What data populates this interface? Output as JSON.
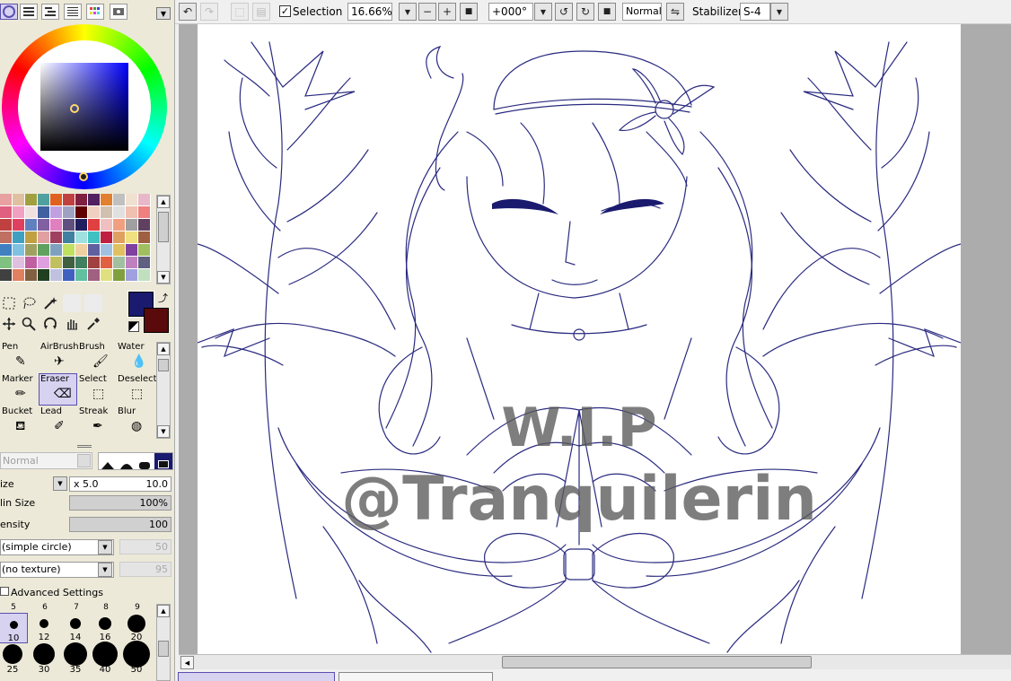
{
  "color_modes": [
    {
      "icon": "color-wheel-icon",
      "selected": true
    },
    {
      "icon": "rgb-sliders-icon",
      "selected": false
    },
    {
      "icon": "hsv-sliders-icon",
      "selected": false
    },
    {
      "icon": "color-mixer-icon",
      "selected": false
    },
    {
      "icon": "swatches-icon",
      "selected": false
    },
    {
      "icon": "scratchpad-icon",
      "selected": false
    }
  ],
  "colors": {
    "foreground": "#1a1a6e",
    "background": "#5a0a0a",
    "selection_accent": "#5a4fb0",
    "palette": [
      "#e8a0a0",
      "#e0c0a0",
      "#a0a040",
      "#50a0a0",
      "#e06020",
      "#c04040",
      "#802040",
      "#502060",
      "#e08030",
      "#c0c0c0",
      "#f0e0d0",
      "#e8b8c8",
      "#e06080",
      "#f0a0c0",
      "#f0e0e0",
      "#4060a0",
      "#c0a0e0",
      "#a0a0c0",
      "#600000",
      "#f0d0c0",
      "#d0c0b0",
      "#e0e0e0",
      "#f0c0b0",
      "#f08080",
      "#c04040",
      "#e04060",
      "#6080c0",
      "#8060a0",
      "#e080c0",
      "#605080",
      "#202060",
      "#e04040",
      "#f0c0c0",
      "#f0a080",
      "#a0a0a0",
      "#604060",
      "#c07060",
      "#40a0c0",
      "#c0a040",
      "#e0a0a0",
      "#a04060",
      "#4080a0",
      "#a0e0e0",
      "#40c0c0",
      "#c02040",
      "#e0a060",
      "#f0e080",
      "#a06040",
      "#4080c0",
      "#80c0e0",
      "#a0a060",
      "#60a060",
      "#80a0c0",
      "#c0e060",
      "#f0d0a0",
      "#6060a0",
      "#a0c0e0",
      "#e0c060",
      "#8040a0",
      "#a0c060",
      "#80c080",
      "#e0c0e0",
      "#c060a0",
      "#e0a0e0",
      "#c0c060",
      "#406040",
      "#408060",
      "#a04040",
      "#e06040",
      "#a0c0a0",
      "#c080c0",
      "#606080",
      "#404040",
      "#e08060",
      "#806040",
      "#204020",
      "#c0c0e0",
      "#4060c0",
      "#60c0a0",
      "#a06080",
      "#e0e080",
      "#80a040",
      "#a0a0e0",
      "#c0e0c0"
    ]
  },
  "tools": [
    {
      "label": "Pen",
      "icon": "pen-icon",
      "selected": false
    },
    {
      "label": "AirBrush",
      "icon": "airbrush-icon",
      "selected": false
    },
    {
      "label": "Brush",
      "icon": "brush-icon",
      "selected": false
    },
    {
      "label": "Water",
      "icon": "water-icon",
      "selected": false
    },
    {
      "label": "Marker",
      "icon": "marker-icon",
      "selected": false
    },
    {
      "label": "Eraser",
      "icon": "eraser-icon",
      "selected": true
    },
    {
      "label": "Select",
      "icon": "select-icon",
      "selected": false
    },
    {
      "label": "Deselect",
      "icon": "deselect-icon",
      "selected": false
    },
    {
      "label": "Bucket",
      "icon": "bucket-icon",
      "selected": false
    },
    {
      "label": "Lead",
      "icon": "lead-icon",
      "selected": false
    },
    {
      "label": "Streak",
      "icon": "streak-icon",
      "selected": false
    },
    {
      "label": "Blur",
      "icon": "blur-icon",
      "selected": false
    }
  ],
  "brush": {
    "blend_mode": "Normal",
    "size_label": "ize",
    "size_multiplier": "x 5.0",
    "size_value": "10.0",
    "min_size_label": "lin Size",
    "min_size_value": "100%",
    "density_label": "ensity",
    "density_value": "100",
    "shape": "(simple circle)",
    "shape_value": "50",
    "texture": "(no texture)",
    "texture_value": "95",
    "advanced_label": "Advanced Settings",
    "sizes": [
      {
        "top": "5",
        "size": "10",
        "selected": true
      },
      {
        "top": "6",
        "size": "12",
        "selected": false
      },
      {
        "top": "7",
        "size": "14",
        "selected": false
      },
      {
        "top": "8",
        "size": "16",
        "selected": false
      },
      {
        "top": "9",
        "size": "20",
        "selected": false
      },
      {
        "size": "25"
      },
      {
        "size": "30"
      },
      {
        "size": "35"
      },
      {
        "size": "40"
      },
      {
        "size": "50"
      }
    ]
  },
  "toolbar": {
    "selection_label": "Selection",
    "selection_checked": true,
    "zoom": "16.66%",
    "rotation": "+000°",
    "blend_mode": "Normal",
    "stabilizer_label": "Stabilizer",
    "stabilizer_value": "S-4"
  },
  "canvas": {
    "watermark_line1": "W.I.P",
    "watermark_line2": "@Tranquilerin",
    "line_color": "#2a2a80"
  }
}
